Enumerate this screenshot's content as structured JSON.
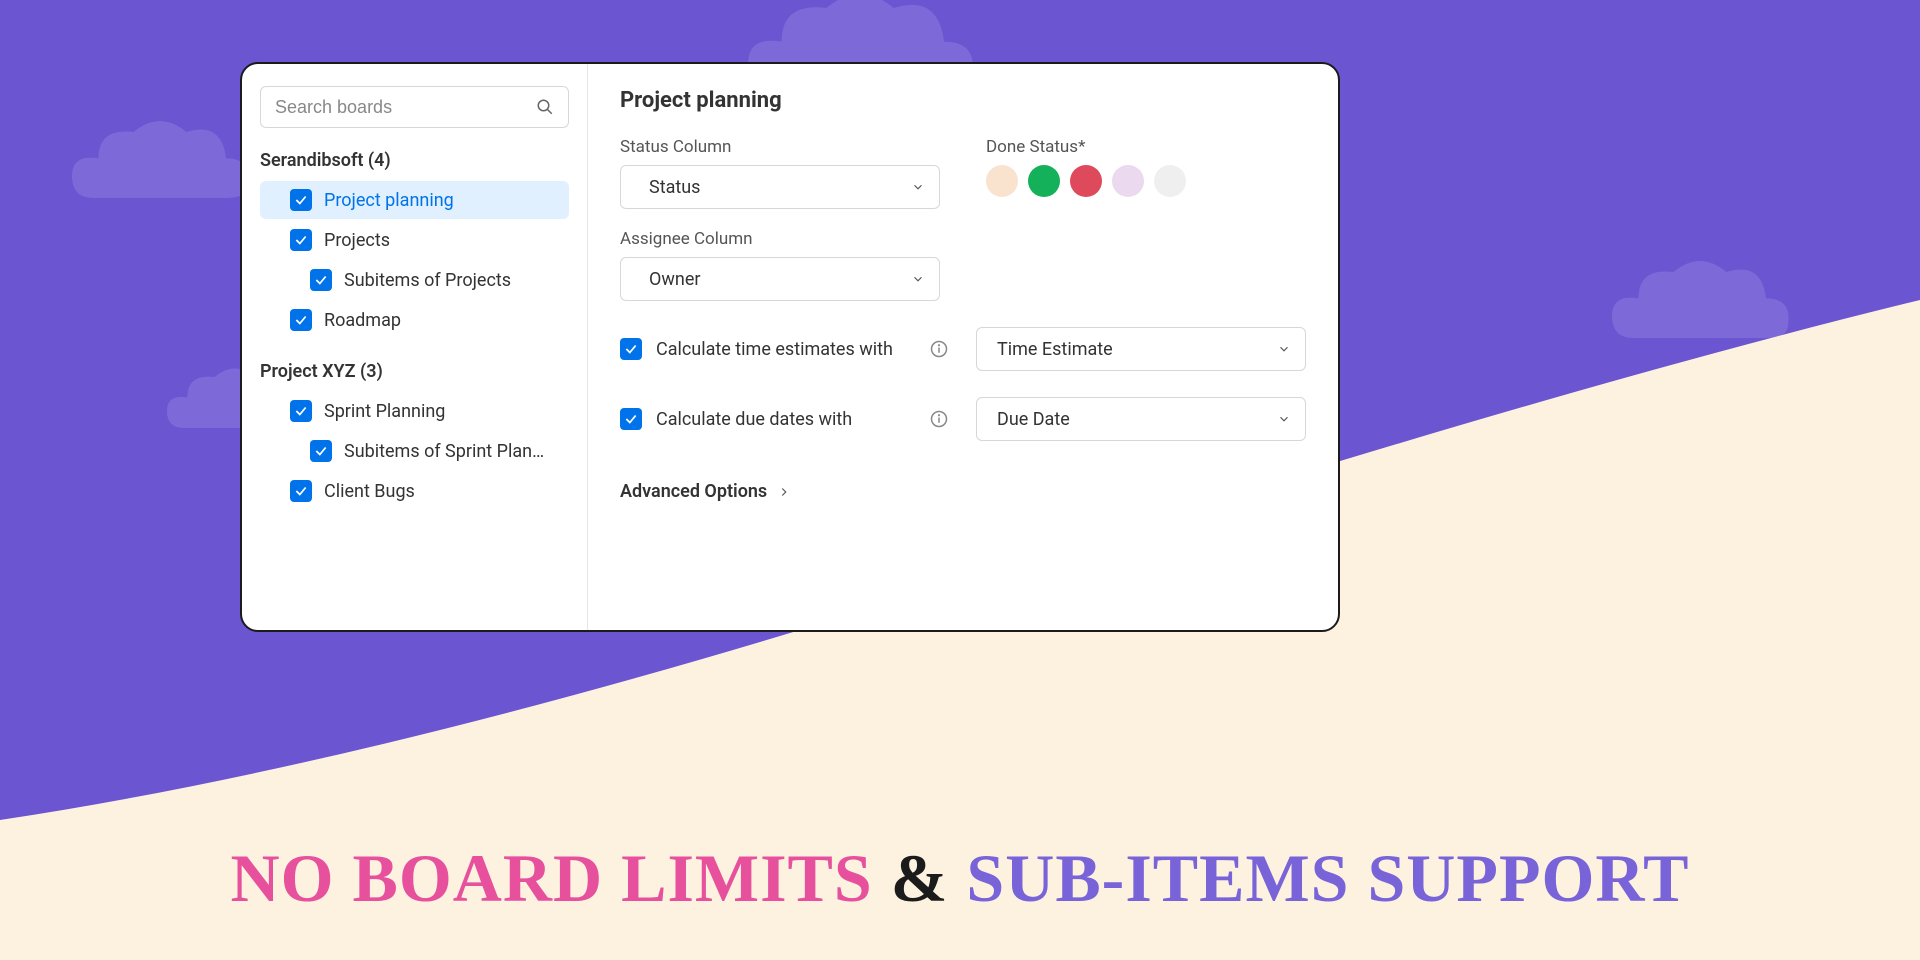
{
  "search": {
    "placeholder": "Search boards"
  },
  "groups": [
    {
      "title": "Serandibsoft (4)",
      "items": [
        {
          "label": "Project planning",
          "checked": true,
          "selected": true,
          "indent": 1
        },
        {
          "label": "Projects",
          "checked": true,
          "indent": 1
        },
        {
          "label": "Subitems of Projects",
          "checked": true,
          "indent": 2
        },
        {
          "label": "Roadmap",
          "checked": true,
          "indent": 1
        }
      ]
    },
    {
      "title": "Project XYZ (3)",
      "items": [
        {
          "label": "Sprint Planning",
          "checked": true,
          "indent": 1
        },
        {
          "label": "Subitems of Sprint Plan…",
          "checked": true,
          "indent": 2
        },
        {
          "label": "Client Bugs",
          "checked": true,
          "indent": 1
        }
      ]
    }
  ],
  "detail": {
    "title": "Project planning",
    "status_label": "Status Column",
    "status_value": "Status",
    "done_label": "Done Status*",
    "done_colors": [
      "#fae3ce",
      "#14b15a",
      "#de4a5c",
      "#ead9ef",
      "#efefef"
    ],
    "assignee_label": "Assignee Column",
    "assignee_value": "Owner",
    "opt1_label": "Calculate time estimates with",
    "opt1_value": "Time Estimate",
    "opt2_label": "Calculate due dates with",
    "opt2_value": "Due Date",
    "advanced": "Advanced Options"
  },
  "tagline": {
    "part1": "NO BOARD LIMITS",
    "amp": "&",
    "part2": "SUB-ITEMS SUPPORT"
  }
}
